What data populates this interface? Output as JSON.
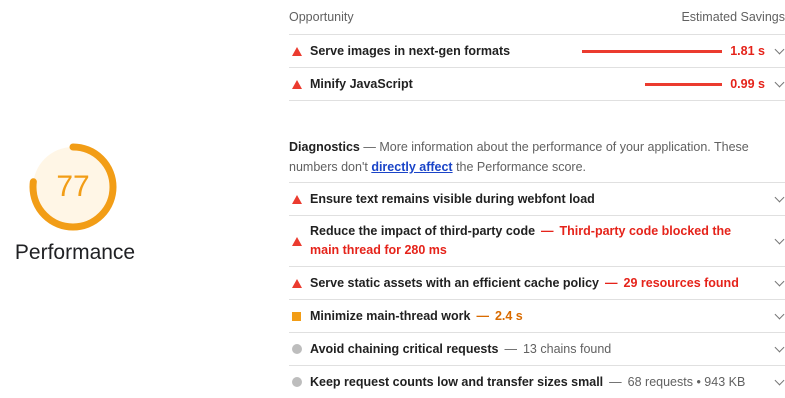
{
  "score": {
    "value": "77",
    "fraction": 0.77,
    "label": "Performance",
    "color": "#f29d16"
  },
  "opportunity": {
    "header_left": "Opportunity",
    "header_right": "Estimated Savings",
    "items": [
      {
        "title": "Serve images in next-gen formats",
        "savings": "1.81 s",
        "savings_fraction": 1.0
      },
      {
        "title": "Minify JavaScript",
        "savings": "0.99 s",
        "savings_fraction": 0.55
      }
    ]
  },
  "diagnostics": {
    "heading": "Diagnostics",
    "dash": "—",
    "text_before": "More information about the performance of your application. These numbers don't",
    "link": "directly affect",
    "text_after": "the Performance score.",
    "items": [
      {
        "icon": "warning-triangle-icon",
        "title": "Ensure text remains visible during webfont load",
        "detail": ""
      },
      {
        "icon": "warning-triangle-icon",
        "title": "Reduce the impact of third-party code",
        "detail": "Third-party code blocked the main thread for 280 ms"
      },
      {
        "icon": "warning-triangle-icon",
        "title": "Serve static assets with an efficient cache policy",
        "detail": "29 resources found"
      },
      {
        "icon": "average-square-icon",
        "title": "Minimize main-thread work",
        "detail": "2.4 s"
      },
      {
        "icon": "info-circle-icon",
        "title": "Avoid chaining critical requests",
        "detail": "13 chains found"
      },
      {
        "icon": "info-circle-icon",
        "title": "Keep request counts low and transfer sizes small",
        "detail": "68 requests • 943 KB"
      }
    ]
  },
  "colors": {
    "fail": "#eb3b2f",
    "average": "#f29d16",
    "info": "#bdbdbd"
  }
}
